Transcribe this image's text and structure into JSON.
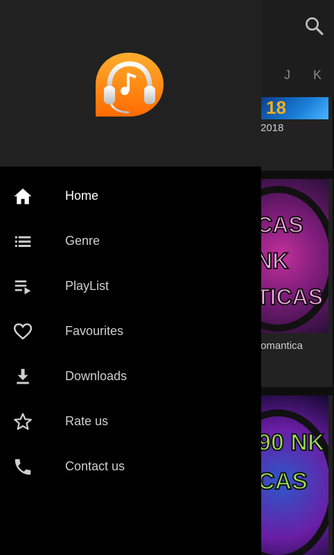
{
  "background": {
    "tabs": [
      "J",
      "K"
    ],
    "cards": [
      {
        "art_text": "18",
        "caption": "2018"
      },
      {
        "art_text": "CAS NK TICAS",
        "caption": "omantica"
      },
      {
        "art_text": "90 NK CAS",
        "caption": ""
      }
    ],
    "search_icon": "search-icon"
  },
  "drawer": {
    "logo": "headphones-music-logo",
    "accent": "#ff7a00",
    "items": [
      {
        "label": "Home",
        "icon": "home-icon",
        "active": true
      },
      {
        "label": "Genre",
        "icon": "list-icon",
        "active": false
      },
      {
        "label": "PlayList",
        "icon": "playlist-icon",
        "active": false
      },
      {
        "label": "Favourites",
        "icon": "heart-icon",
        "active": false
      },
      {
        "label": "Downloads",
        "icon": "download-icon",
        "active": false
      },
      {
        "label": "Rate us",
        "icon": "star-icon",
        "active": false
      },
      {
        "label": "Contact us",
        "icon": "phone-icon",
        "active": false
      }
    ]
  }
}
